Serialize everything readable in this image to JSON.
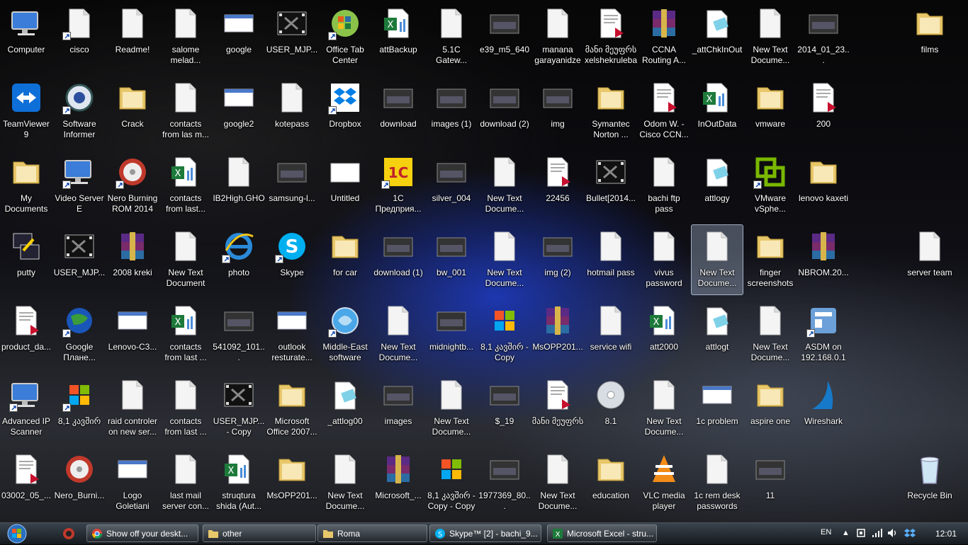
{
  "desktop": {
    "columns": [
      [
        "Computer",
        "TeamViewer\n9",
        "My\nDocuments",
        "putty",
        "product_da...",
        "Advanced IP\nScanner",
        "03002_05_..."
      ],
      [
        "cisco",
        "Software\nInformer",
        "Video Server\nE",
        "USER_MJP...",
        "Google\nПлане...",
        "8,1 კავშირ",
        "Nero_Burni..."
      ],
      [
        "Readme!",
        "Crack",
        "Nero Burning\nROM 2014",
        "2008 kreki",
        "Lenovo-C3...",
        "raid controler\non new ser...",
        "Logo\nGoletiani"
      ],
      [
        "salome\nmelad...",
        "contacts\nfrom las m...",
        "contacts\nfrom last...",
        "New Text\nDocument",
        "contacts\nfrom last ...",
        "contacts\nfrom last ...",
        "last mail\nserver con..."
      ],
      [
        "google",
        "google2",
        "IB2High.GHO",
        "photo",
        "541092_101...",
        "USER_MJP...\n- Copy",
        "struqtura\nshida (Aut..."
      ],
      [
        "USER_MJP...",
        "kotepass",
        "samsung-l...",
        "Skype",
        "outlook\nresturate...",
        "Microsoft\nOffice 2007...",
        "MsOPP201..."
      ],
      [
        "Office Tab\nCenter",
        "Dropbox",
        "Untitled",
        "for car",
        "Middle-East\nsoftware",
        "_attlog00",
        "New Text\nDocume..."
      ],
      [
        "attBackup",
        "download",
        "1C\nПредприя...",
        "download (1)",
        "New Text\nDocume...",
        "images",
        "Microsoft_..."
      ],
      [
        "5.1C\nGatew...",
        "images (1)",
        "silver_004",
        "bw_001",
        "midnightb...",
        "New Text\nDocume...",
        "8,1 კავშირ -\nCopy - Copy"
      ],
      [
        "e39_m5_640",
        "download (2)",
        "New Text\nDocume...",
        "New Text\nDocume...",
        "8,1 კავშირ -\nCopy",
        "$_19",
        "1977369_80..."
      ],
      [
        "manana\ngarayanidze",
        "img",
        "22456",
        "img (2)",
        "MsOPP201...",
        "მანი მეუფრს",
        "New Text\nDocume..."
      ],
      [
        "მანი მეუფრს\nxelshekruleba",
        "Symantec\nNorton ...",
        "Bullet[2014...",
        "hotmail pass",
        "service wifi",
        "8.1",
        "education"
      ],
      [
        "CCNA\nRouting A...",
        "Odom W. -\nCisco CCN...",
        "bachi ftp\npass",
        "vivus\npassword",
        "att2000",
        "New Text\nDocume...",
        "VLC media\nplayer"
      ],
      [
        "_attChkInOut",
        "InOutData",
        "attlogy",
        "New Text\nDocume...",
        "attlogt",
        "1c problem",
        "1c rem desk\npasswords"
      ],
      [
        "New Text\nDocume...",
        "vmware",
        "VMware\nvSphe...",
        "finger\nscreenshots",
        "New Text\nDocume...",
        "aspire one",
        "11"
      ],
      [
        "2014_01_23...",
        "200",
        "lenovo kaxeti",
        "NBROM.20...",
        "ASDM on\n192.168.0.1",
        "Wireshark",
        ""
      ]
    ],
    "extra": {
      "films": "films",
      "server_team": "server team",
      "recycle_bin": "Recycle Bin"
    }
  },
  "taskbar": {
    "tasks": [
      {
        "label": "Show off your deskt...",
        "icon": "chrome-icon"
      },
      {
        "label": "other",
        "icon": "folder-icon"
      },
      {
        "label": "Roma",
        "icon": "folder-icon"
      },
      {
        "label": "Skype™ [2] - bachi_9...",
        "icon": "skype-icon"
      },
      {
        "label": "Microsoft Excel - stru...",
        "icon": "excel-icon"
      }
    ],
    "tray": {
      "language": "EN",
      "clock": "12:01"
    }
  },
  "colors": {
    "folder": "#e8c76a",
    "doc": "#f4f4f4",
    "excel": "#1d7a3a",
    "pdf": "#c8102e",
    "winrar": "#7a2b6b",
    "skype": "#00aff0",
    "ie": "#2b8ad8",
    "dropbox": "#007ee5"
  }
}
